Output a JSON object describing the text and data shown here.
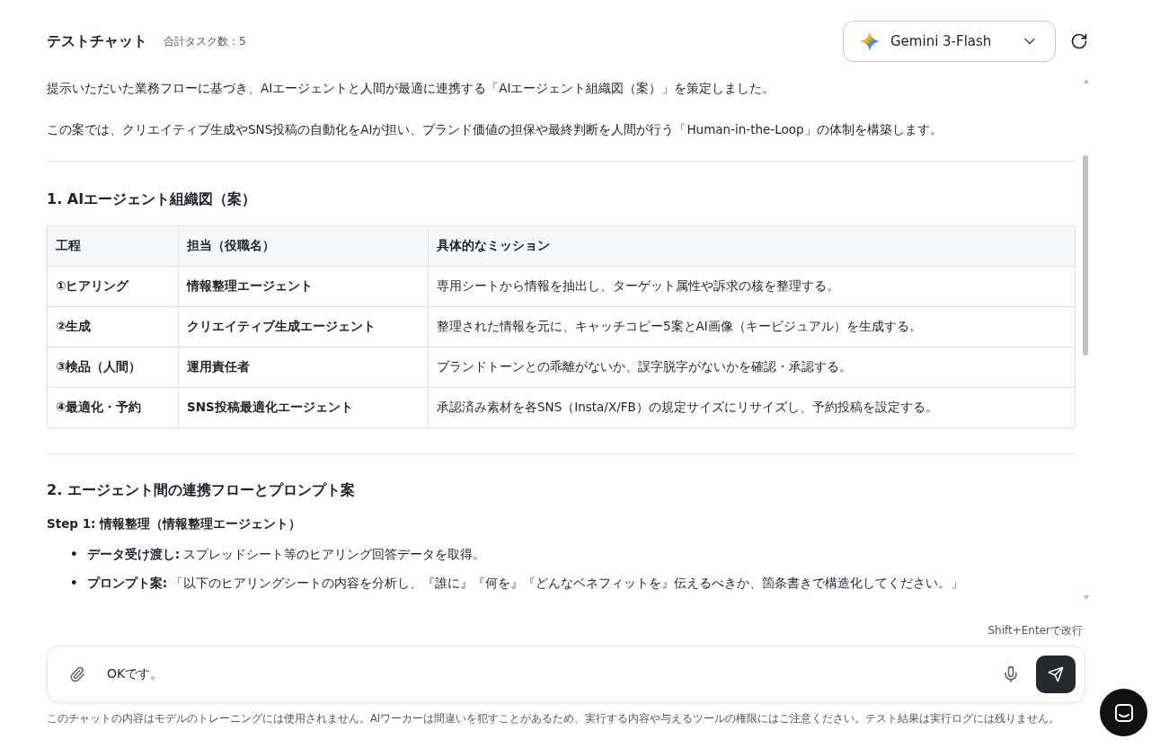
{
  "header": {
    "title": "テストチャット",
    "task_count": "合計タスク数：5",
    "model": "Gemini 3-Flash"
  },
  "intro": [
    "提示いただいた業務フローに基づき、AIエージェントと人間が最適に連携する「AIエージェント組織図（案）」を策定しました。",
    "この案では、クリエイティブ生成やSNS投稿の自動化をAIが担い、ブランド価値の担保や最終判断を人間が行う「Human-in-the-Loop」の体制を構築します。"
  ],
  "section1": {
    "heading": "1. AIエージェント組織図（案）",
    "table": {
      "columns": [
        "工程",
        "担当（役職名）",
        "具体的なミッション"
      ],
      "rows": [
        [
          "①ヒアリング",
          "情報整理エージェント",
          "専用シートから情報を抽出し、ターゲット属性や訴求の核を整理する。"
        ],
        [
          "②生成",
          "クリエイティブ生成エージェント",
          "整理された情報を元に、キャッチコピー5案とAI画像（キービジュアル）を生成する。"
        ],
        [
          "③検品（人間）",
          "運用責任者",
          "ブランドトーンとの乖離がないか、誤字脱字がないかを確認・承認する。"
        ],
        [
          "④最適化・予約",
          "SNS投稿最適化エージェント",
          "承認済み素材を各SNS（Insta/X/FB）の規定サイズにリサイズし、予約投稿を設定する。"
        ]
      ]
    }
  },
  "section2": {
    "heading": "2. エージェント間の連携フローとプロンプト案",
    "step": "Step 1: 情報整理（情報整理エージェント）",
    "marker": "•",
    "bullets": [
      "**データ受け渡し:** スプレッドシート等のヒアリング回答データを取得。",
      "**プロンプト案:** 「以下のヒアリングシートの内容を分析し、『誰に』『何を』『どんなベネフィットを』伝えるべきか、箇条書きで構造化してください。」"
    ]
  },
  "composer": {
    "hint": "Shift+Enterで改行",
    "value": "OKです。"
  },
  "disclaimer": "このチャットの内容はモデルのトレーニングには使用されません。AIワーカーは間違いを犯すことがあるため、実行する内容や与えるツールの権限にはご注意ください。テスト結果は実行ログには残りません。"
}
